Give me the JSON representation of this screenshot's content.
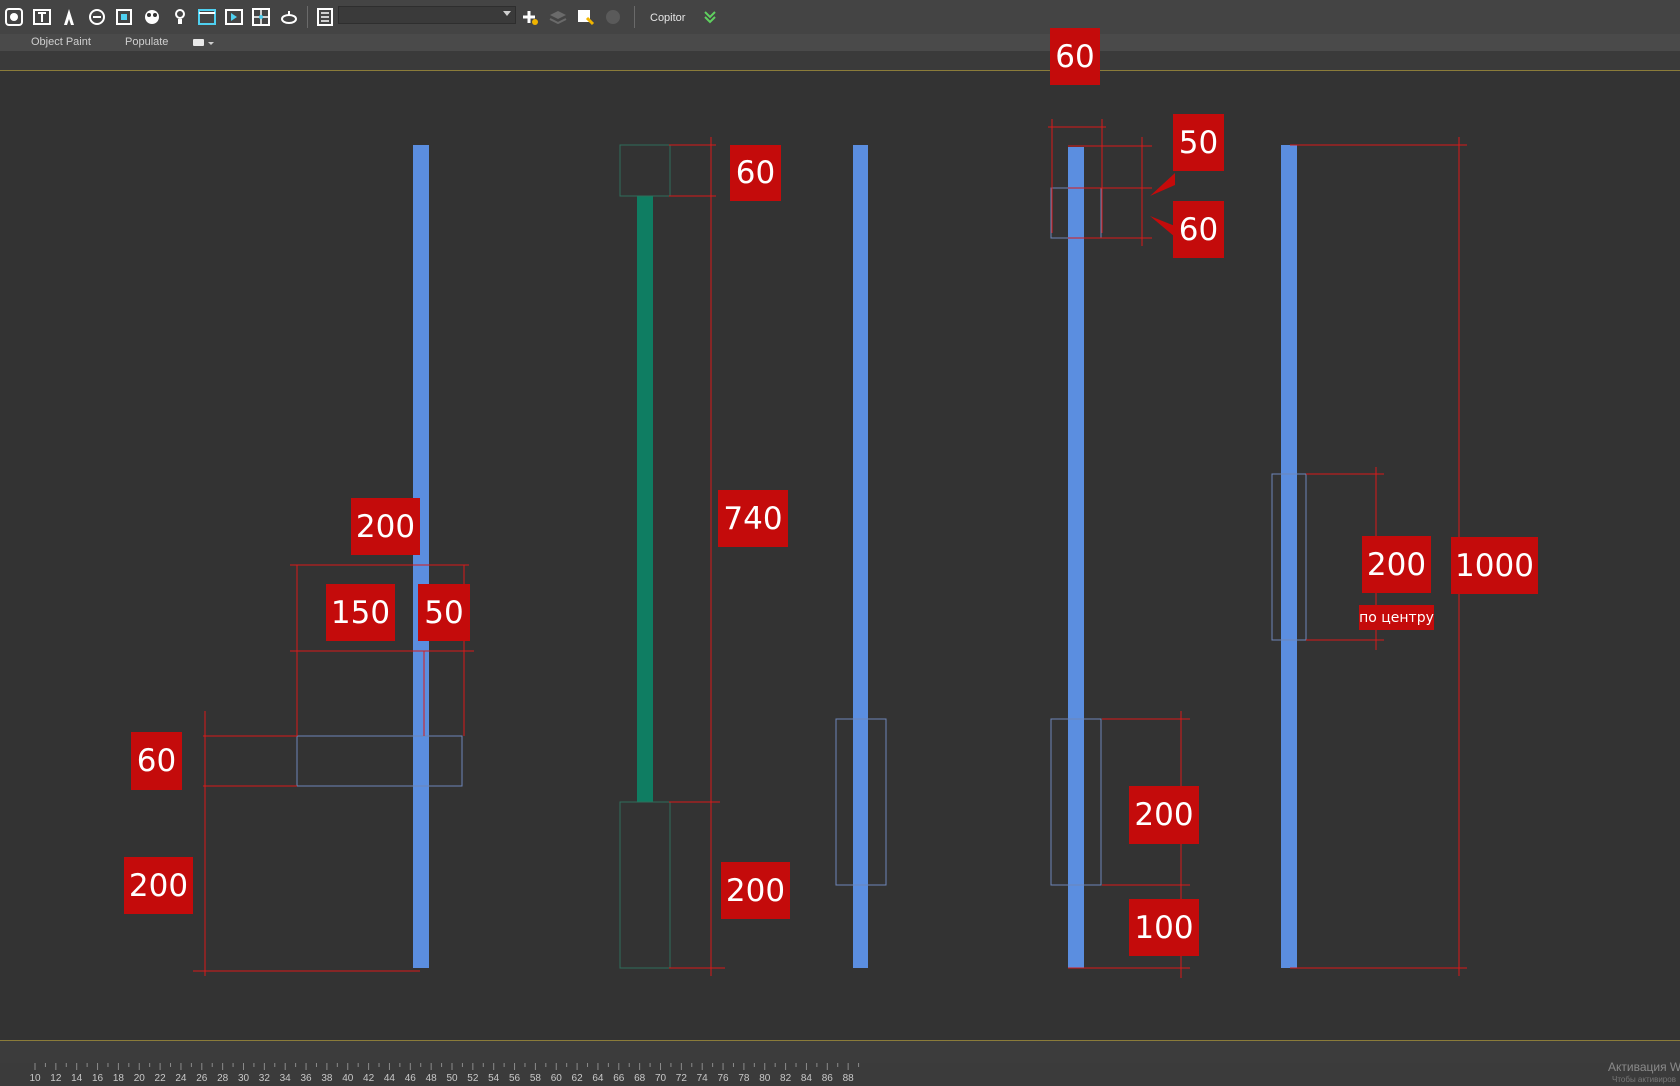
{
  "toolbar": {
    "icons": [
      "selection-filter-icon",
      "text-icon",
      "font-icon",
      "hand-icon",
      "schematic-icon",
      "material-editor-icon",
      "light-icon",
      "render-setup-icon",
      "render-frame-icon",
      "viewport-layout-icon",
      "teapot-render-icon",
      "layer-manager-icon"
    ],
    "named_selection_value": "",
    "extra_icons": [
      "add-layer-icon",
      "stack-icon",
      "select-object-icon",
      "grid-icon"
    ],
    "copitor_label": "Copitor",
    "expand_icon": "double-chevron-down-icon"
  },
  "ribbon": {
    "tabs": [
      "Object Paint",
      "Populate"
    ],
    "options_icon": "ribbon-options-icon"
  },
  "colors": {
    "accent_red": "#c40b0b",
    "dimension_line": "#d81a1a",
    "pipe_blue": "#5b8ee0",
    "pipe_green": "#0f7d62",
    "outline_blue": "#6e86b8",
    "outline_green": "#2f6e5b",
    "viewport_bg": "#333333"
  },
  "dimensions": {
    "object1": {
      "width_total": "200",
      "offset_left": "150",
      "offset_right": "50",
      "box_height": "60",
      "height_from_floor": "200"
    },
    "object2": {
      "top_box": "60",
      "middle": "740",
      "bottom_box": "200"
    },
    "object4": {
      "top_offset": "60",
      "gap": "50",
      "top_box": "60",
      "bottom_box": "200",
      "bottom_gap": "100"
    },
    "object5": {
      "box_height": "200",
      "note": "по центру",
      "total_height": "1000"
    }
  },
  "ruler": {
    "labels": [
      "10",
      "12",
      "14",
      "16",
      "18",
      "20",
      "22",
      "24",
      "26",
      "28",
      "30",
      "32",
      "34",
      "36",
      "38",
      "40",
      "42",
      "44",
      "46",
      "48",
      "50",
      "52",
      "54",
      "56",
      "58",
      "60",
      "62",
      "64",
      "66",
      "68",
      "70",
      "72",
      "74",
      "76",
      "78",
      "80",
      "82",
      "84",
      "86",
      "88"
    ]
  },
  "watermark": {
    "title": "Активация W",
    "subtitle": "Чтобы активиров"
  }
}
